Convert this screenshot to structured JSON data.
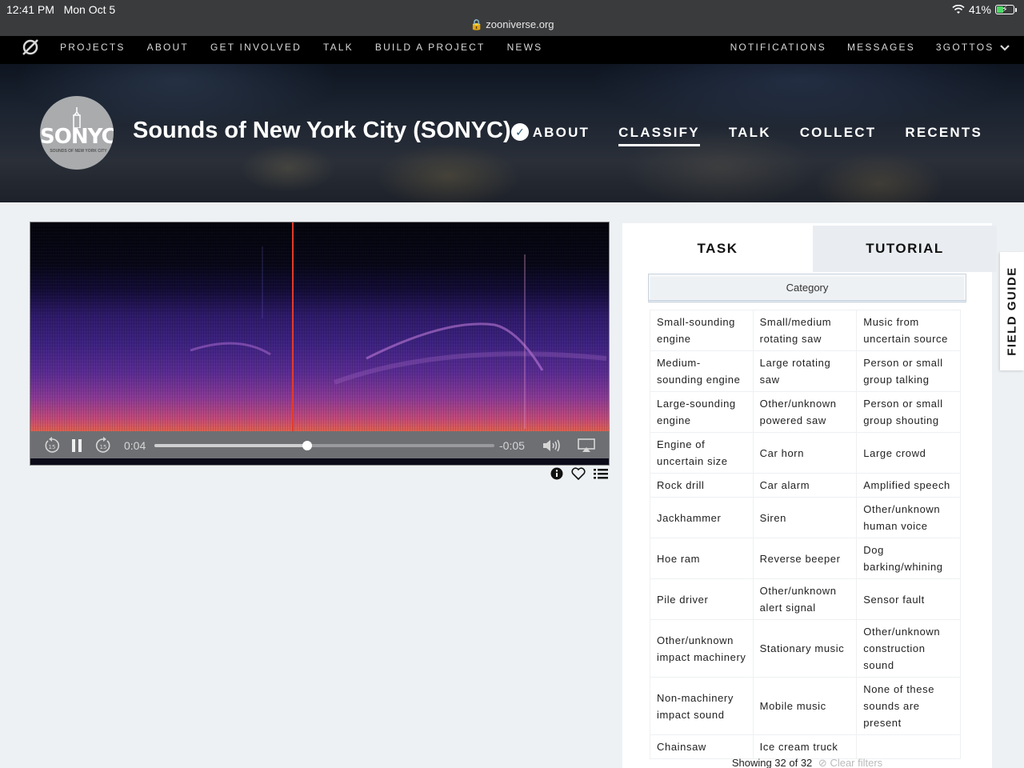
{
  "status_bar": {
    "time": "12:41 PM",
    "date": "Mon Oct 5",
    "battery": "41%",
    "battery_level": 0.41,
    "url": "zooniverse.org"
  },
  "topnav": {
    "left": [
      "PROJECTS",
      "ABOUT",
      "GET INVOLVED",
      "TALK",
      "BUILD A PROJECT",
      "NEWS"
    ],
    "right": [
      "NOTIFICATIONS",
      "MESSAGES",
      "3GOTTOS"
    ]
  },
  "project": {
    "logo_text": "SONYC",
    "logo_sub": "SOUNDS OF NEW YORK CITY",
    "title": "Sounds of New York City (SONYC)",
    "verified_icon": "check-badge-icon",
    "nav": [
      "ABOUT",
      "CLASSIFY",
      "TALK",
      "COLLECT",
      "RECENTS"
    ],
    "active_nav": "CLASSIFY"
  },
  "player": {
    "elapsed": "0:04",
    "remaining": "-0:05",
    "progress": 0.45,
    "colors": {
      "playhead": "#e33a2a"
    }
  },
  "task_panel": {
    "tabs": {
      "task": "TASK",
      "tutorial": "TUTORIAL"
    },
    "category_label": "Category",
    "rows": [
      [
        "Small-sounding engine",
        "Small/medium rotating saw",
        "Music from uncertain source"
      ],
      [
        "Medium-sounding engine",
        "Large rotating saw",
        "Person or small group talking"
      ],
      [
        "Large-sounding engine",
        "Other/unknown powered saw",
        "Person or small group shouting"
      ],
      [
        "Engine of uncertain size",
        "Car horn",
        "Large crowd"
      ],
      [
        "Rock drill",
        "Car alarm",
        "Amplified speech"
      ],
      [
        "Jackhammer",
        "Siren",
        "Other/unknown human voice"
      ],
      [
        "Hoe ram",
        "Reverse beeper",
        "Dog barking/whining"
      ],
      [
        "Pile driver",
        "Other/unknown alert signal",
        "Sensor fault"
      ],
      [
        "Other/unknown impact machinery",
        "Stationary music",
        "Other/unknown construction sound"
      ],
      [
        "Non-machinery impact sound",
        "Mobile music",
        "None of these sounds are present"
      ],
      [
        "Chainsaw",
        "Ice cream truck",
        ""
      ]
    ],
    "showing": "Showing 32 of 32",
    "clear_filters": "Clear filters"
  },
  "field_guide": "FIELD GUIDE"
}
